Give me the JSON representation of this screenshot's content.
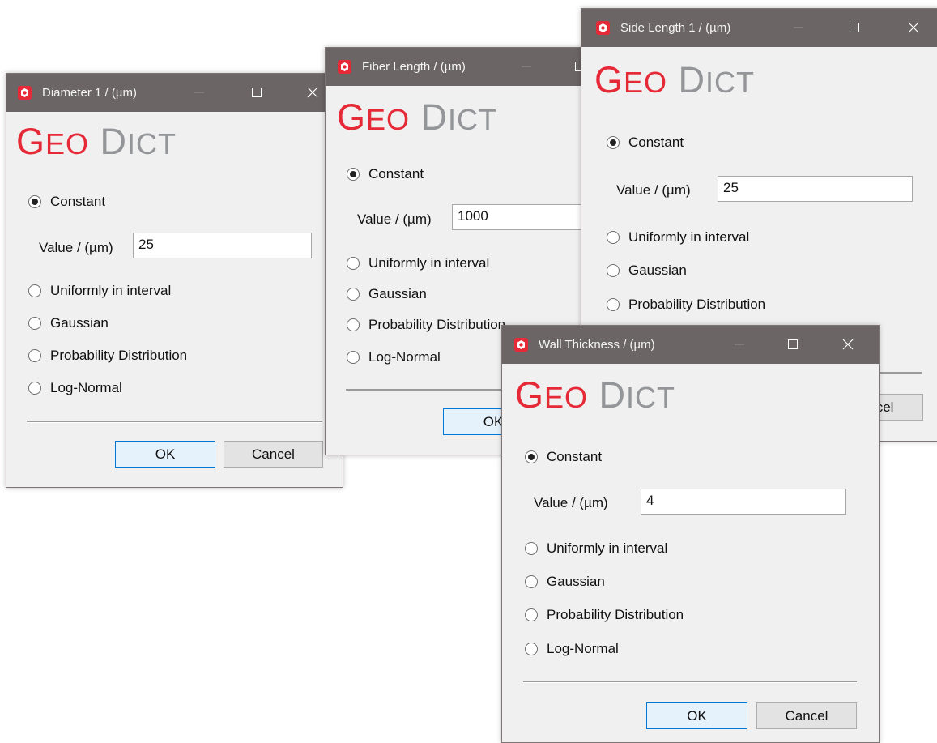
{
  "logo": {
    "geo": "GEO",
    "dict": "DICT"
  },
  "dialogs": {
    "diameter": {
      "title": "Diameter 1 / (µm)",
      "constant": "Constant",
      "value_label": "Value / (µm)",
      "value": "25",
      "uniform": "Uniformly in interval",
      "gaussian": "Gaussian",
      "probability": "Probability Distribution",
      "lognormal": "Log-Normal",
      "ok": "OK",
      "cancel": "Cancel"
    },
    "fiber": {
      "title": "Fiber Length / (µm)",
      "constant": "Constant",
      "value_label": "Value / (µm)",
      "value": "1000",
      "uniform": "Uniformly in interval",
      "gaussian": "Gaussian",
      "probability": "Probability Distribution",
      "lognormal": "Log-Normal",
      "ok": "OK"
    },
    "side": {
      "title": "Side Length 1 / (µm)",
      "constant": "Constant",
      "value_label": "Value / (µm)",
      "value": "25",
      "uniform": "Uniformly in interval",
      "gaussian": "Gaussian",
      "probability": "Probability Distribution",
      "cancel": "Cancel"
    },
    "wall": {
      "title": "Wall Thickness / (µm)",
      "constant": "Constant",
      "value_label": "Value / (µm)",
      "value": "4",
      "uniform": "Uniformly in interval",
      "gaussian": "Gaussian",
      "probability": "Probability Distribution",
      "lognormal": "Log-Normal",
      "ok": "OK",
      "cancel": "Cancel"
    }
  },
  "icons": {
    "app": "geodict-app-icon",
    "minimize": "minimize-icon",
    "maximize": "maximize-icon",
    "close": "close-icon"
  },
  "colors": {
    "titlebar": "#6b6565",
    "logo_red": "#e62937",
    "logo_gray": "#939598",
    "ok_border": "#0078d7"
  }
}
